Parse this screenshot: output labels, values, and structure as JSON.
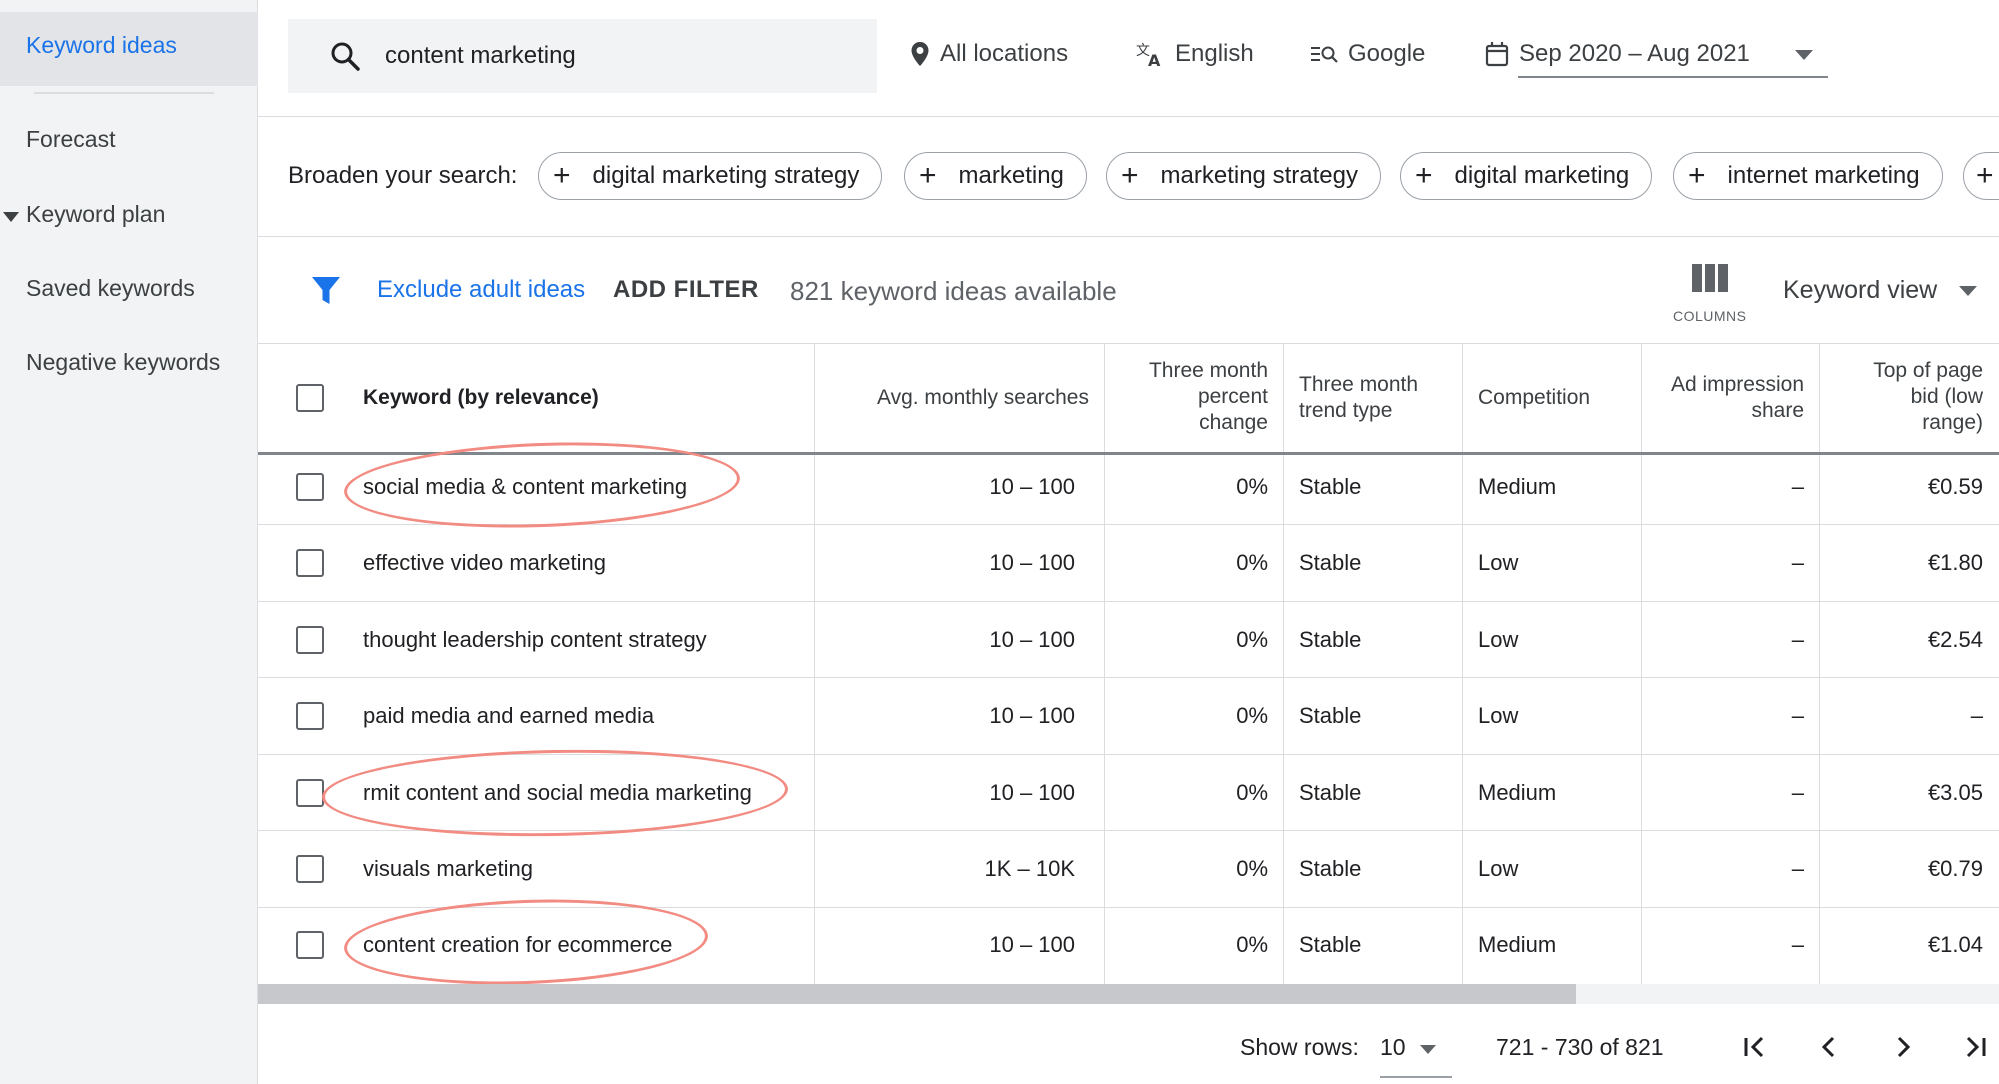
{
  "sidebar": {
    "items": [
      {
        "label": "Keyword ideas"
      },
      {
        "label": "Forecast"
      },
      {
        "label": "Keyword plan"
      },
      {
        "label": "Saved keywords"
      },
      {
        "label": "Negative keywords"
      }
    ]
  },
  "search": {
    "value": "content marketing"
  },
  "top_bar": {
    "location": "All locations",
    "language": "English",
    "network": "Google",
    "date_range": "Sep 2020 – Aug 2021"
  },
  "broaden": {
    "label": "Broaden your search:",
    "chips": [
      "digital marketing strategy",
      "marketing",
      "marketing strategy",
      "digital marketing",
      "internet marketing"
    ]
  },
  "filter_bar": {
    "exclude_adult": "Exclude adult ideas",
    "add_filter": "ADD FILTER",
    "ideas_count": "821 keyword ideas available",
    "columns_label": "COLUMNS",
    "view_label": "Keyword view"
  },
  "table": {
    "headers": {
      "keyword": "Keyword (by relevance)",
      "avg_searches": "Avg. monthly searches",
      "three_month_change": [
        "Three month",
        "percent",
        "change"
      ],
      "trend_type": [
        "Three month",
        "trend type"
      ],
      "competition": "Competition",
      "impression_share": [
        "Ad impression",
        "share"
      ],
      "top_bid": [
        "Top of page",
        "bid (low",
        "range)"
      ]
    },
    "rows": [
      {
        "keyword": "social media & content marketing",
        "searches": "10 – 100",
        "change": "0%",
        "trend": "Stable",
        "competition": "Medium",
        "share": "–",
        "bid": "€0.59"
      },
      {
        "keyword": "effective video marketing",
        "searches": "10 – 100",
        "change": "0%",
        "trend": "Stable",
        "competition": "Low",
        "share": "–",
        "bid": "€1.80"
      },
      {
        "keyword": "thought leadership content strategy",
        "searches": "10 – 100",
        "change": "0%",
        "trend": "Stable",
        "competition": "Low",
        "share": "–",
        "bid": "€2.54"
      },
      {
        "keyword": "paid media and earned media",
        "searches": "10 – 100",
        "change": "0%",
        "trend": "Stable",
        "competition": "Low",
        "share": "–",
        "bid": "–"
      },
      {
        "keyword": "rmit content and social media marketing",
        "searches": "10 – 100",
        "change": "0%",
        "trend": "Stable",
        "competition": "Medium",
        "share": "–",
        "bid": "€3.05"
      },
      {
        "keyword": "visuals marketing",
        "searches": "1K – 10K",
        "change": "0%",
        "trend": "Stable",
        "competition": "Low",
        "share": "–",
        "bid": "€0.79"
      },
      {
        "keyword": "content creation for ecommerce",
        "searches": "10 – 100",
        "change": "0%",
        "trend": "Stable",
        "competition": "Medium",
        "share": "–",
        "bid": "€1.04"
      }
    ]
  },
  "pagination": {
    "show_rows_label": "Show rows:",
    "rows_value": "10",
    "range": "721 - 730 of 821"
  },
  "colors": {
    "accent": "#1a73e8",
    "highlight_ellipse": "#f28b82"
  }
}
